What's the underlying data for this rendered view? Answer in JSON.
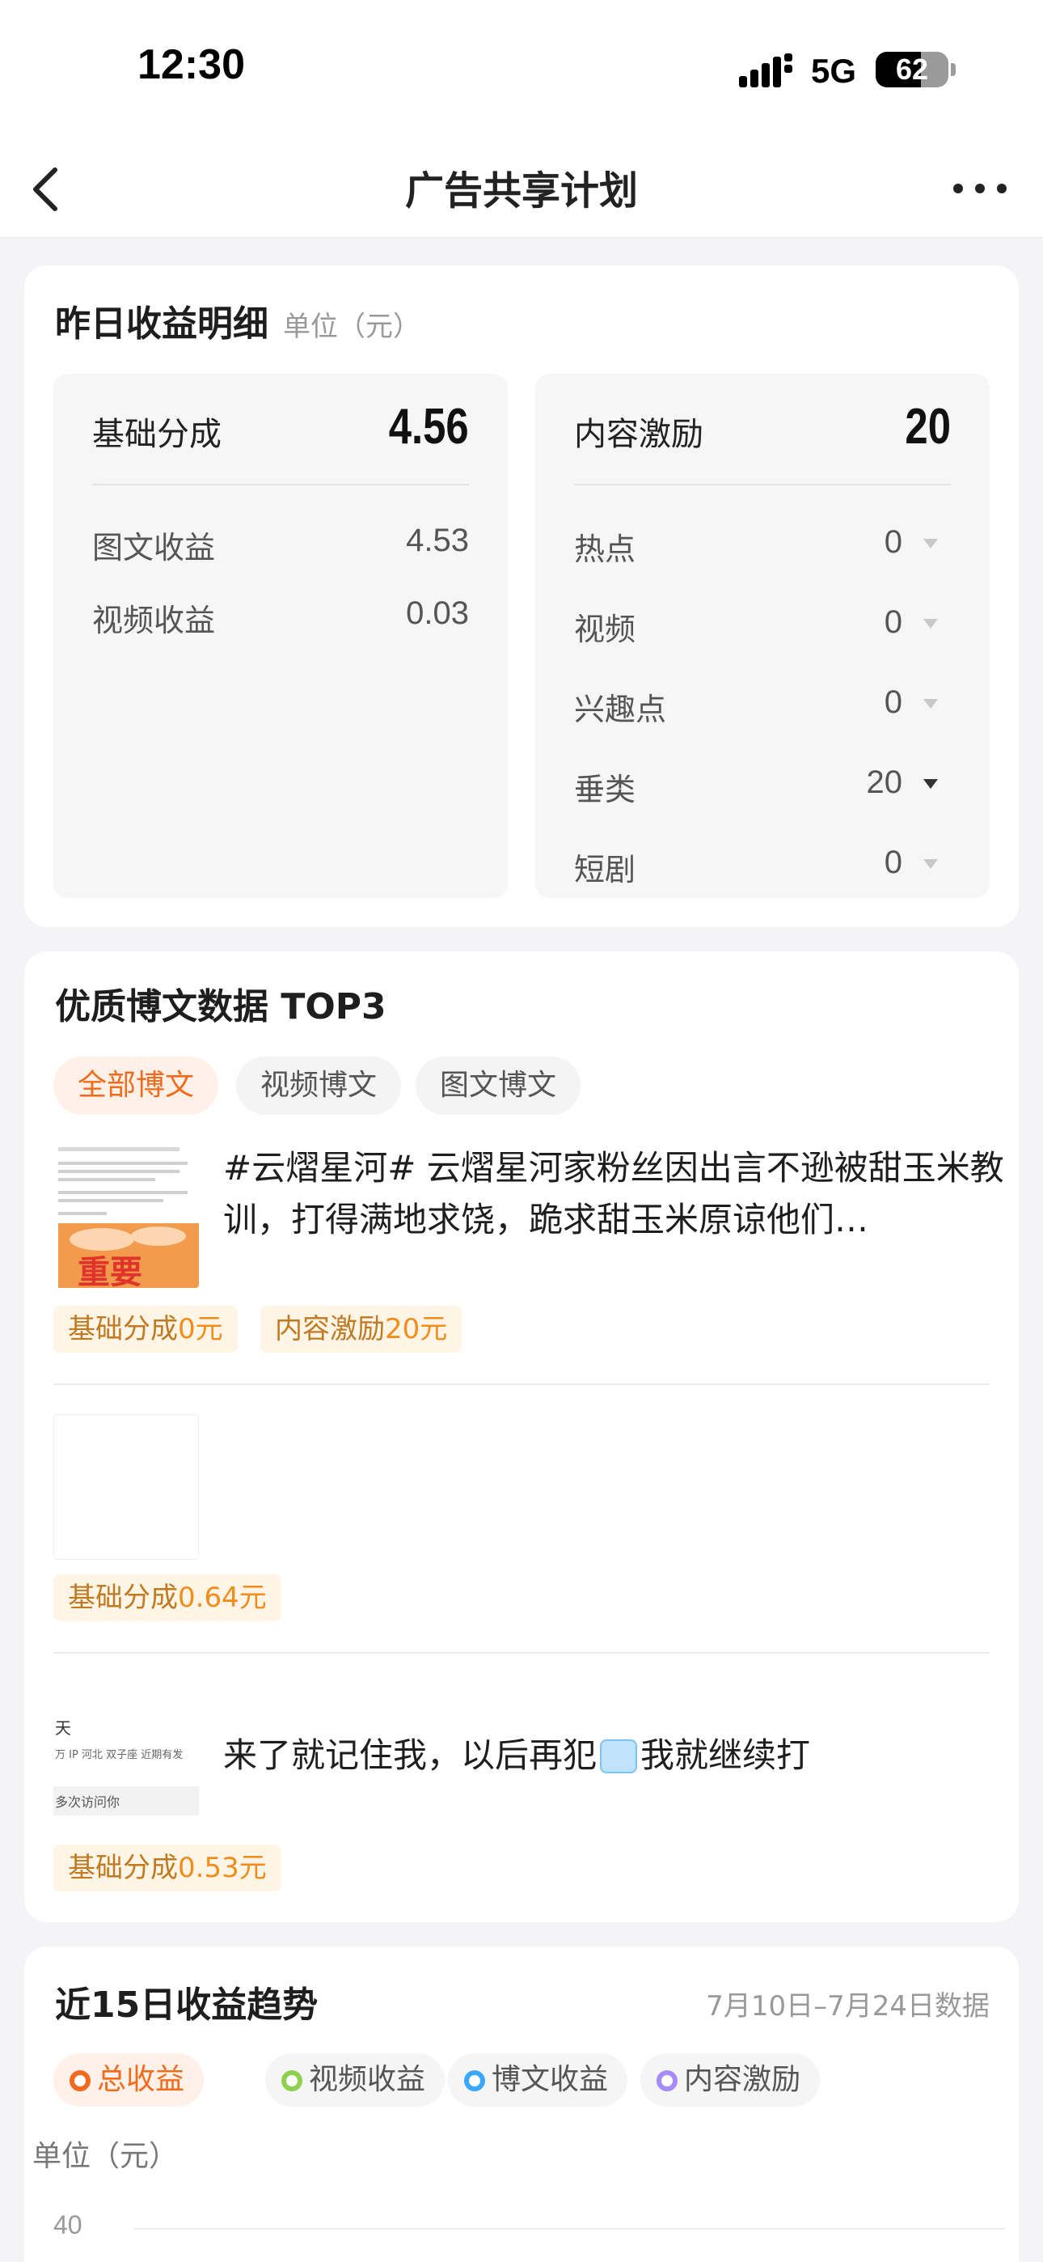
{
  "status_bar": {
    "time": "12:30",
    "network": "5G",
    "battery": "62",
    "battery_level": 0.62
  },
  "nav": {
    "title": "广告共享计划"
  },
  "earnings": {
    "title": "昨日收益明细",
    "unit": "单位（元）",
    "basic": {
      "label": "基础分成",
      "value": "4.56",
      "rows": [
        {
          "label": "图文收益",
          "value": "4.53"
        },
        {
          "label": "视频收益",
          "value": "0.03"
        }
      ]
    },
    "content": {
      "label": "内容激励",
      "value": "20",
      "rows": [
        {
          "label": "热点",
          "value": "0"
        },
        {
          "label": "视频",
          "value": "0"
        },
        {
          "label": "兴趣点",
          "value": "0"
        },
        {
          "label": "垂类",
          "value": "20"
        },
        {
          "label": "短剧",
          "value": "0"
        }
      ]
    }
  },
  "top3": {
    "title": "优质博文数据 TOP3",
    "filters": [
      "全部博文",
      "视频博文",
      "图文博文"
    ],
    "posts": [
      {
        "title": "#云熠星河# 云熠星河家粉丝因出言不逊被甜玉米教训，打得满地求饶，跪求甜玉米原谅他们…",
        "thumb_text": "重要",
        "tags": [
          {
            "label": "基础分成",
            "amount": "0元"
          },
          {
            "label": "内容激励",
            "amount": "20元"
          }
        ]
      },
      {
        "title": "",
        "tags": [
          {
            "label": "基础分成",
            "amount": "0.64元"
          }
        ]
      },
      {
        "title": "来了就记住我，以后再犯",
        "title_suffix": "我就继续打",
        "thumb_lines": [
          "天",
          "万  IP 河北  双子座  近期有发",
          "多次访问你"
        ],
        "tags": [
          {
            "label": "基础分成",
            "amount": "0.53元"
          }
        ]
      }
    ]
  },
  "trend": {
    "title": "近15日收益趋势",
    "range": "7月10日–7月24日数据",
    "legend": [
      {
        "label": "总收益",
        "color": "#f26b1d"
      },
      {
        "label": "视频收益",
        "color": "#8fd14f"
      },
      {
        "label": "博文收益",
        "color": "#3aa8ff"
      },
      {
        "label": "内容激励",
        "color": "#a78bfa"
      }
    ],
    "unit": "单位（元）",
    "y_tick_top": "40"
  }
}
